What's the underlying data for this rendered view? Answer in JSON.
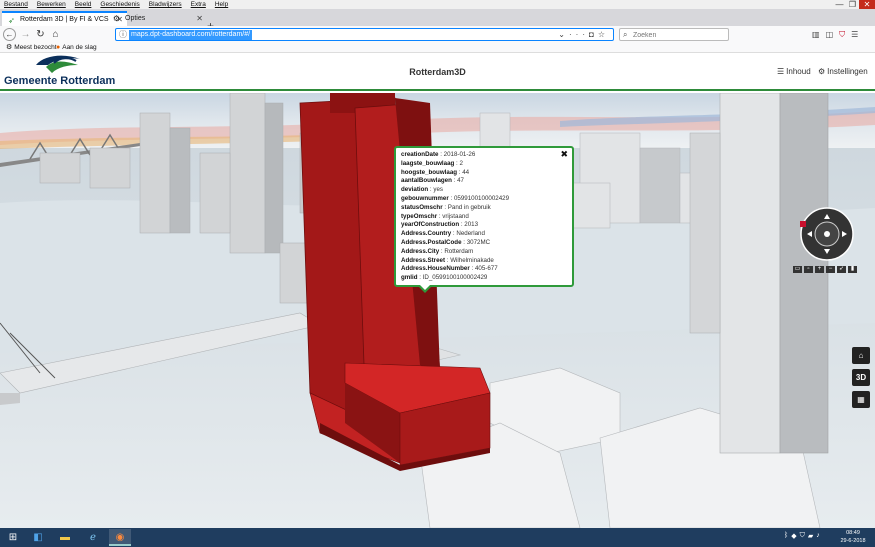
{
  "browser": {
    "menu": [
      "Bestand",
      "Bewerken",
      "Beeld",
      "Geschiedenis",
      "Bladwijzers",
      "Extra",
      "Help"
    ],
    "tabs": [
      {
        "label": "Rotterdam 3D | By FI & VCS",
        "icon": "app-favicon"
      },
      {
        "label": "Opties",
        "icon": "gear-icon"
      }
    ],
    "url": "maps.dpt-dashboard.com/rotterdam/#/",
    "search_placeholder": "Zoeken",
    "bookmarks": [
      {
        "label": "Meest bezocht",
        "icon": "gear-icon"
      },
      {
        "label": "Aan de slag",
        "icon": "firefox-icon"
      }
    ]
  },
  "app": {
    "logo_text": "Gemeente Rotterdam",
    "title": "Rotterdam3D",
    "inhoud_label": "Inhoud",
    "instellingen_label": "Instellingen"
  },
  "popup": {
    "rows": [
      {
        "key": "creationDate",
        "value": "2018-01-26"
      },
      {
        "key": "laagste_bouwlaag",
        "value": "2"
      },
      {
        "key": "hoogste_bouwlaag",
        "value": "44"
      },
      {
        "key": "aantalBouwlagen",
        "value": "47"
      },
      {
        "key": "deviation",
        "value": "yes"
      },
      {
        "key": "gebouwnummer",
        "value": "0599100100002429"
      },
      {
        "key": "statusOmschr",
        "value": "Pand in gebruik"
      },
      {
        "key": "typeOmschr",
        "value": "vrijstaand"
      },
      {
        "key": "yearOfConstruction",
        "value": "2013"
      },
      {
        "key": "Address.Country",
        "value": "Nederland"
      },
      {
        "key": "Address.PostalCode",
        "value": "3072MC"
      },
      {
        "key": "Address.City",
        "value": "Rotterdam"
      },
      {
        "key": "Address.Street",
        "value": "Wilhelminakade"
      },
      {
        "key": "Address.HouseNumber",
        "value": "405-677"
      },
      {
        "key": "gmlid",
        "value": "ID_0599100100002429"
      }
    ]
  },
  "map_controls": {
    "side_buttons": [
      {
        "label": "⌂",
        "name": "home-button"
      },
      {
        "label": "3D",
        "name": "3d-toggle-button"
      },
      {
        "label": "▦",
        "name": "grid-button"
      }
    ]
  },
  "taskbar": {
    "time": "08:49",
    "date": "29-6-2018"
  },
  "colors": {
    "accent_green": "#2e8b3a",
    "building_red": "#a01818",
    "url_blue": "#0a84ff"
  }
}
